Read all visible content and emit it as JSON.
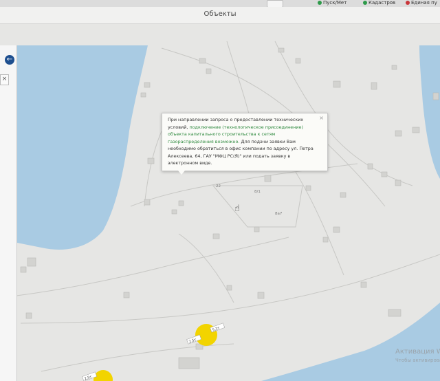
{
  "toolbar": {
    "item1": "Пуск/Мет",
    "item2": "Кадастров",
    "item3": "Единая пу"
  },
  "window": {
    "title": "Объекты"
  },
  "left_panel": {
    "back_glyph": "←",
    "close_glyph": "×"
  },
  "popup": {
    "text_before": "При направлении запроса о предоставлении технических условий,",
    "text_green": "подключение (технологическое присоединение) объекта капитального строительства к сетям газораспределения возможно.",
    "text_after": "Для подачи заявки Вам необходимо обратиться в офис компании по адресу ул. Петра Алексеева, 64, ГАУ \"МФЦ РС(Я)\" или подать заявку в электронном виде.",
    "close_glyph": "×"
  },
  "map": {
    "parcel_labels": [
      "22",
      "8/1",
      "8а7"
    ],
    "marker_labels": [
      "2,5т",
      "5,1т",
      "2,5т"
    ],
    "colors": {
      "water": "#a9cbe3",
      "land": "#e6e6e4",
      "marker": "#f2d400"
    }
  },
  "watermark": {
    "line1": "Активация W",
    "line2": "Чтобы активировать"
  }
}
